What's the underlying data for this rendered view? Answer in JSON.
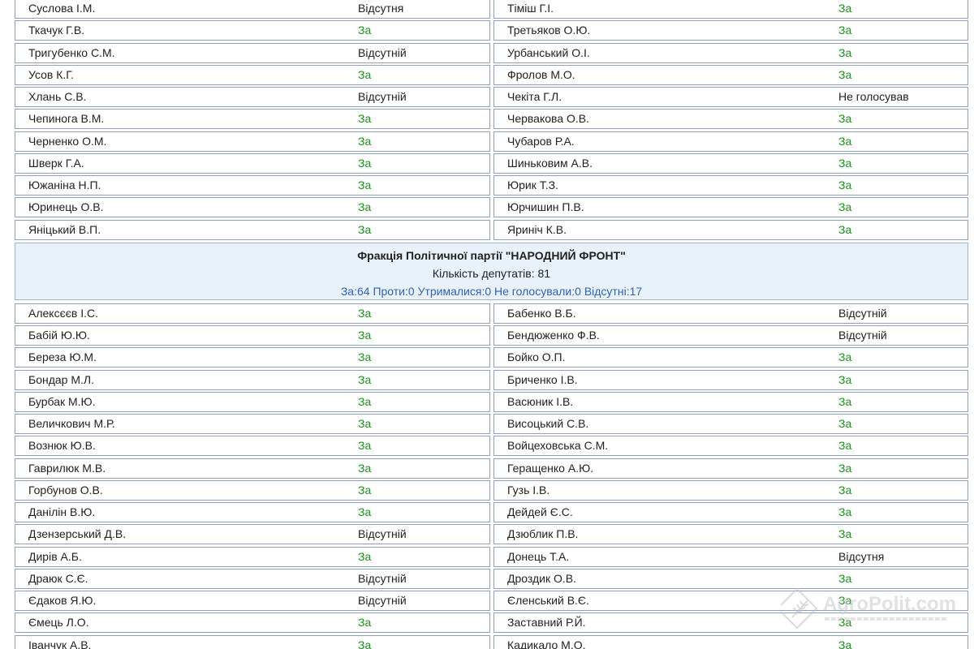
{
  "top_rows": [
    {
      "left": {
        "name": "Суслова І.М.",
        "vote": "Відсутня",
        "for": false
      },
      "right": {
        "name": "Тіміш Г.І.",
        "vote": "За",
        "for": true
      }
    },
    {
      "left": {
        "name": "Ткачук Г.В.",
        "vote": "За",
        "for": true
      },
      "right": {
        "name": "Третьяков О.Ю.",
        "vote": "За",
        "for": true
      }
    },
    {
      "left": {
        "name": "Тригубенко С.М.",
        "vote": "Відсутній",
        "for": false
      },
      "right": {
        "name": "Урбанський О.І.",
        "vote": "За",
        "for": true
      }
    },
    {
      "left": {
        "name": "Усов К.Г.",
        "vote": "За",
        "for": true
      },
      "right": {
        "name": "Фролов М.О.",
        "vote": "За",
        "for": true
      }
    },
    {
      "left": {
        "name": "Хлань С.В.",
        "vote": "Відсутній",
        "for": false
      },
      "right": {
        "name": "Чекіта Г.Л.",
        "vote": "Не голосував",
        "for": false
      }
    },
    {
      "left": {
        "name": "Чепинога В.М.",
        "vote": "За",
        "for": true
      },
      "right": {
        "name": "Червакова О.В.",
        "vote": "За",
        "for": true
      }
    },
    {
      "left": {
        "name": "Черненко О.М.",
        "vote": "За",
        "for": true
      },
      "right": {
        "name": "Чубаров Р.А.",
        "vote": "За",
        "for": true
      }
    },
    {
      "left": {
        "name": "Шверк Г.А.",
        "vote": "За",
        "for": true
      },
      "right": {
        "name": "Шиньковим А.В.",
        "vote": "За",
        "for": true
      }
    },
    {
      "left": {
        "name": "Южаніна Н.П.",
        "vote": "За",
        "for": true
      },
      "right": {
        "name": "Юрик Т.З.",
        "vote": "За",
        "for": true
      }
    },
    {
      "left": {
        "name": "Юринець О.В.",
        "vote": "За",
        "for": true
      },
      "right": {
        "name": "Юрчишин П.В.",
        "vote": "За",
        "for": true
      }
    },
    {
      "left": {
        "name": "Яніцький В.П.",
        "vote": "За",
        "for": true
      },
      "right": {
        "name": "Яриніч К.В.",
        "vote": "За",
        "for": true
      }
    }
  ],
  "faction": {
    "title": "Фракція Політичної партії \"НАРОДНИЙ ФРОНТ\"",
    "count": "Кількість депутатів: 81",
    "summary": "За:64 Проти:0 Утрималися:0 Не голосували:0 Відсутні:17"
  },
  "bottom_rows": [
    {
      "left": {
        "name": "Алексєєв І.С.",
        "vote": "За",
        "for": true
      },
      "right": {
        "name": "Бабенко В.Б.",
        "vote": "Відсутній",
        "for": false
      }
    },
    {
      "left": {
        "name": "Бабій Ю.Ю.",
        "vote": "За",
        "for": true
      },
      "right": {
        "name": "Бендюженко Ф.В.",
        "vote": "Відсутній",
        "for": false
      }
    },
    {
      "left": {
        "name": "Береза Ю.М.",
        "vote": "За",
        "for": true
      },
      "right": {
        "name": "Бойко О.П.",
        "vote": "За",
        "for": true
      }
    },
    {
      "left": {
        "name": "Бондар М.Л.",
        "vote": "За",
        "for": true
      },
      "right": {
        "name": "Бриченко І.В.",
        "vote": "За",
        "for": true
      }
    },
    {
      "left": {
        "name": "Бурбак М.Ю.",
        "vote": "За",
        "for": true
      },
      "right": {
        "name": "Васюник І.В.",
        "vote": "За",
        "for": true
      }
    },
    {
      "left": {
        "name": "Величкович М.Р.",
        "vote": "За",
        "for": true
      },
      "right": {
        "name": "Висоцький С.В.",
        "vote": "За",
        "for": true
      }
    },
    {
      "left": {
        "name": "Вознюк Ю.В.",
        "vote": "За",
        "for": true
      },
      "right": {
        "name": "Войцеховська С.М.",
        "vote": "За",
        "for": true
      }
    },
    {
      "left": {
        "name": "Гаврилюк М.В.",
        "vote": "За",
        "for": true
      },
      "right": {
        "name": "Геращенко А.Ю.",
        "vote": "За",
        "for": true
      }
    },
    {
      "left": {
        "name": "Горбунов О.В.",
        "vote": "За",
        "for": true
      },
      "right": {
        "name": "Гузь І.В.",
        "vote": "За",
        "for": true
      }
    },
    {
      "left": {
        "name": "Данілін В.Ю.",
        "vote": "За",
        "for": true
      },
      "right": {
        "name": "Дейдей Є.С.",
        "vote": "За",
        "for": true
      }
    },
    {
      "left": {
        "name": "Дзензерський Д.В.",
        "vote": "Відсутній",
        "for": false
      },
      "right": {
        "name": "Дзюблик П.В.",
        "vote": "За",
        "for": true
      }
    },
    {
      "left": {
        "name": "Дирів А.Б.",
        "vote": "За",
        "for": true
      },
      "right": {
        "name": "Донець Т.А.",
        "vote": "Відсутня",
        "for": false
      }
    },
    {
      "left": {
        "name": "Драюк С.Є.",
        "vote": "Відсутній",
        "for": false
      },
      "right": {
        "name": "Дроздик О.В.",
        "vote": "За",
        "for": true
      }
    },
    {
      "left": {
        "name": "Єдаков Я.Ю.",
        "vote": "Відсутній",
        "for": false
      },
      "right": {
        "name": "Єленський В.Є.",
        "vote": "За",
        "for": true
      }
    },
    {
      "left": {
        "name": "Ємець Л.О.",
        "vote": "За",
        "for": true
      },
      "right": {
        "name": "Заставний Р.Й.",
        "vote": "За",
        "for": true
      }
    },
    {
      "left": {
        "name": "Іванчук А.В.",
        "vote": "За",
        "for": true
      },
      "right": {
        "name": "Кадикало М.О.",
        "vote": "За",
        "for": true
      }
    }
  ],
  "watermark": {
    "text": "AgroPolit.com"
  },
  "colors": {
    "vote_for": "#1e8e1e",
    "summary": "#2f63b5",
    "faction_bg": "#e9f2fb",
    "border": "#8f9fbc"
  }
}
